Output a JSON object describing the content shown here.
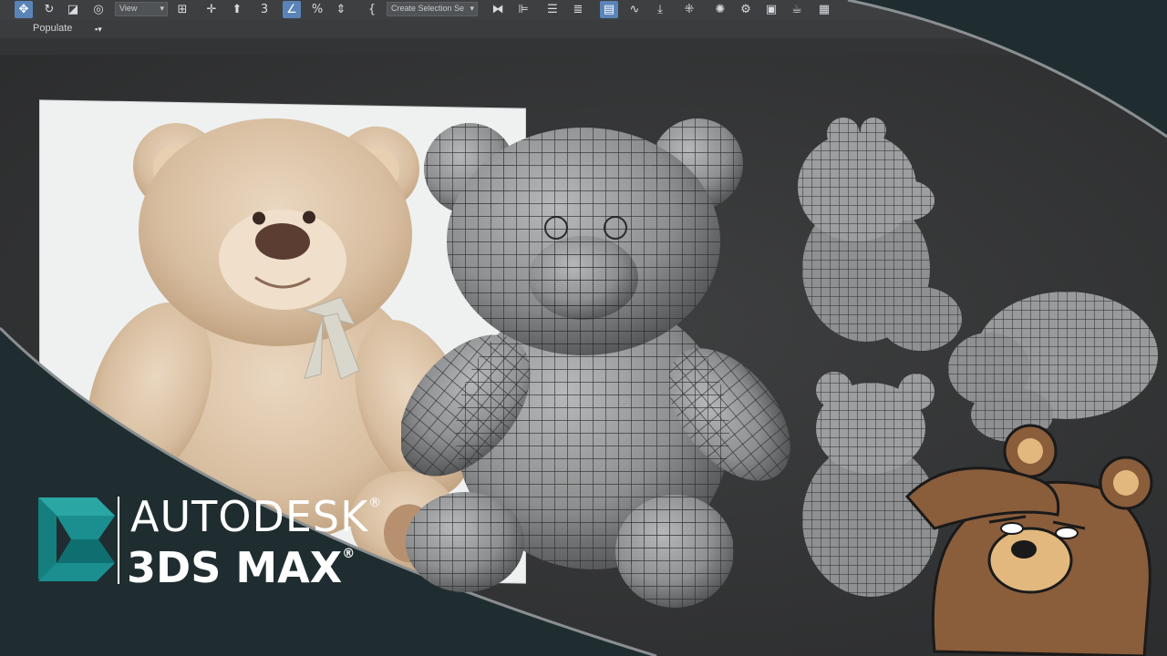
{
  "toolbar": {
    "view_dropdown": "View",
    "selection_set_dropdown": "Create Selection Se",
    "icons": [
      "move-icon",
      "rotate-icon",
      "scale-icon",
      "place-icon",
      "view-dropdown",
      "pivot-icon",
      "snap-toggle-icon",
      "angle-snap-icon",
      "percent-snap-icon",
      "spinner-snap-icon",
      "edit-named-selection-icon",
      "selection-set-dropdown",
      "mirror-icon",
      "align-icon",
      "scene-explorer-icon",
      "layer-explorer-icon",
      "toggle-ribbon-icon",
      "curve-editor-icon",
      "schematic-view-icon",
      "material-editor-icon",
      "render-setup-icon",
      "rendered-frame-icon",
      "render-icon"
    ]
  },
  "ribbon": {
    "populate_label": "Populate"
  },
  "brand": {
    "company": "AUTODESK",
    "product": "3DS MAX",
    "reg_mark": "®"
  },
  "colors": {
    "accent": "#5a84b8",
    "logo_teal": "#1b8f8f",
    "viewport_bg": "#333435",
    "frame_bg": "#1f2d30"
  }
}
